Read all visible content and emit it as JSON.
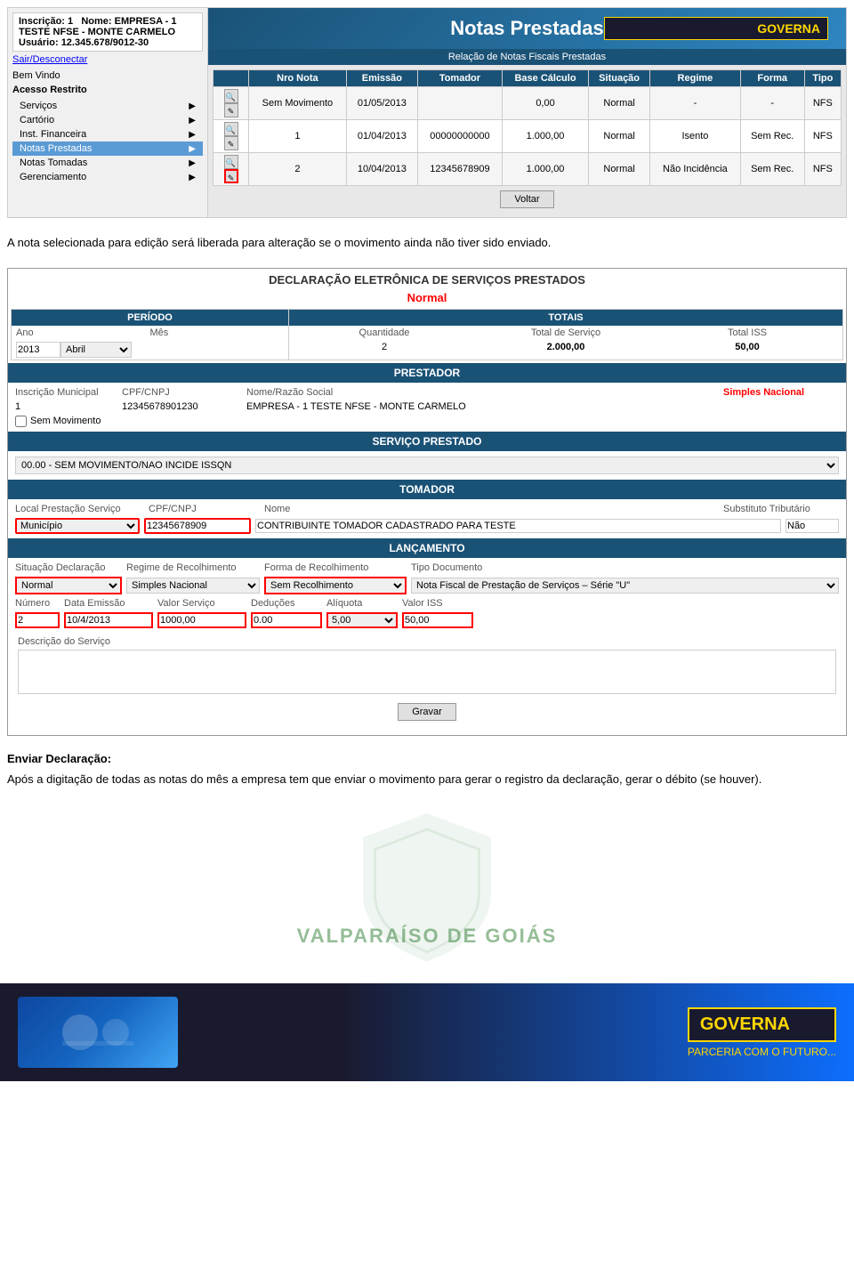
{
  "header": {
    "inscricao_label": "Inscrição:",
    "inscricao_value": "1",
    "nome_label": "Nome:",
    "nome_value": "EMPRESA - 1 TESTE NFSE - MONTE CARMELO",
    "usuario_label": "Usuário:",
    "usuario_value": "12.345.678/9012-30",
    "sair_label": "Sair/Desconectar",
    "bem_vindo": "Bem Vindo",
    "acesso_restrito": "Acesso Restrito",
    "governa": "GOVERNA"
  },
  "menu": {
    "items": [
      {
        "label": "Serviços",
        "arrow": "▶"
      },
      {
        "label": "Cartório",
        "arrow": "▶"
      },
      {
        "label": "Inst. Financeira",
        "arrow": "▶"
      },
      {
        "label": "Notas Prestadas",
        "arrow": "▶",
        "active": true
      },
      {
        "label": "Notas Tomadas",
        "arrow": "▶"
      },
      {
        "label": "Gerenciamento",
        "arrow": "▶"
      }
    ]
  },
  "notas_prestadas": {
    "title": "Notas Prestadas",
    "subtitle": "Relação de Notas Fiscais Prestadas",
    "columns": [
      "Nro Nota",
      "Emissão",
      "Tomador",
      "Base Cálculo",
      "Situação",
      "Regime",
      "Forma",
      "Tipo"
    ],
    "rows": [
      {
        "nro": "Sem Movimento",
        "emissao": "01/05/2013",
        "tomador": "",
        "base_calculo": "0,00",
        "situacao": "Normal",
        "regime": "-",
        "forma": "-",
        "tipo": "NFS"
      },
      {
        "nro": "1",
        "emissao": "01/04/2013",
        "tomador": "00000000000",
        "base_calculo": "1.000,00",
        "situacao": "Normal",
        "regime": "Isento",
        "forma": "Sem Rec.",
        "tipo": "NFS"
      },
      {
        "nro": "2",
        "emissao": "10/04/2013",
        "tomador": "12345678909",
        "base_calculo": "1.000,00",
        "situacao": "Normal",
        "regime": "Não Incidência",
        "forma": "Sem Rec.",
        "tipo": "NFS"
      }
    ],
    "voltar_label": "Voltar"
  },
  "middle_text": "A nota selecionada para edição será liberada para alteração se o movimento ainda não tiver sido enviado.",
  "declaration": {
    "title": "DECLARAÇÃO ELETRÔNICA DE SERVIÇOS PRESTADOS",
    "subtitle": "Normal",
    "periodo": {
      "header": "PERÍODO",
      "ano_label": "Ano",
      "mes_label": "Mês",
      "ano_value": "2013",
      "mes_value": "Abril"
    },
    "totais": {
      "header": "TOTAIS",
      "quantidade_label": "Quantidade",
      "total_servico_label": "Total de Serviço",
      "total_iss_label": "Total ISS",
      "quantidade_value": "2",
      "total_servico_value": "2.000,00",
      "total_iss_value": "50,00"
    },
    "prestador": {
      "header": "PRESTADOR",
      "insc_label": "Inscrição Municipal",
      "cpf_label": "CPF/CNPJ",
      "nome_label": "Nome/Razão Social",
      "simples_label": "Simples Nacional",
      "insc_value": "1",
      "cpf_value": "12345678901230",
      "nome_value": "EMPRESA - 1 TESTE NFSE - MONTE CARMELO",
      "sem_movimento_label": "Sem Movimento"
    },
    "servico": {
      "header": "SERVIÇO PRESTADO",
      "option": "00.00 - SEM MOVIMENTO/NAO INCIDE ISSQN"
    },
    "tomador": {
      "header": "TOMADOR",
      "local_label": "Local Prestação Serviço",
      "cpf_label": "CPF/CNPJ",
      "nome_label": "Nome",
      "subst_label": "Substituto Tributário",
      "local_value": "Município",
      "cpf_value": "12345678909",
      "nome_value": "CONTRIBUINTE TOMADOR CADASTRADO PARA TESTE",
      "subst_value": "Não"
    },
    "lancamento": {
      "header": "LANÇAMENTO",
      "situacao_label": "Situação Declaração",
      "regime_label": "Regime de Recolhimento",
      "forma_label": "Forma de Recolhimento",
      "tipo_label": "Tipo Documento",
      "situacao_value": "Normal",
      "regime_value": "Simples Nacional",
      "forma_value": "Sem Recolhimento",
      "tipo_value": "Nota Fiscal de Prestação de Serviços – Série \"U\"",
      "numero_label": "Número",
      "data_label": "Data Emissão",
      "valor_label": "Valor Serviço",
      "deducoes_label": "Deduções",
      "aliquota_label": "Alíquota",
      "valor_iss_label": "Valor ISS",
      "numero_value": "2",
      "data_value": "10/4/2013",
      "valor_value": "1000,00",
      "deducoes_value": "0.00",
      "aliquota_value": "5,00",
      "valor_iss_value": "50,00",
      "descricao_label": "Descrição do Serviço",
      "gravar_label": "Gravar"
    }
  },
  "enviar": {
    "title": "Enviar Declaração:",
    "text": "Após a digitação de todas as notas do mês a empresa tem que enviar o movimento para gerar o registro da declaração, gerar o débito (se houver)."
  },
  "watermark": {
    "text": "VALPARAÍSO DE GOIÁS"
  },
  "footer": {
    "governa": "GOVERNA",
    "parceria": "PARCERIA COM",
    "futuro": "O FUTURO..."
  }
}
